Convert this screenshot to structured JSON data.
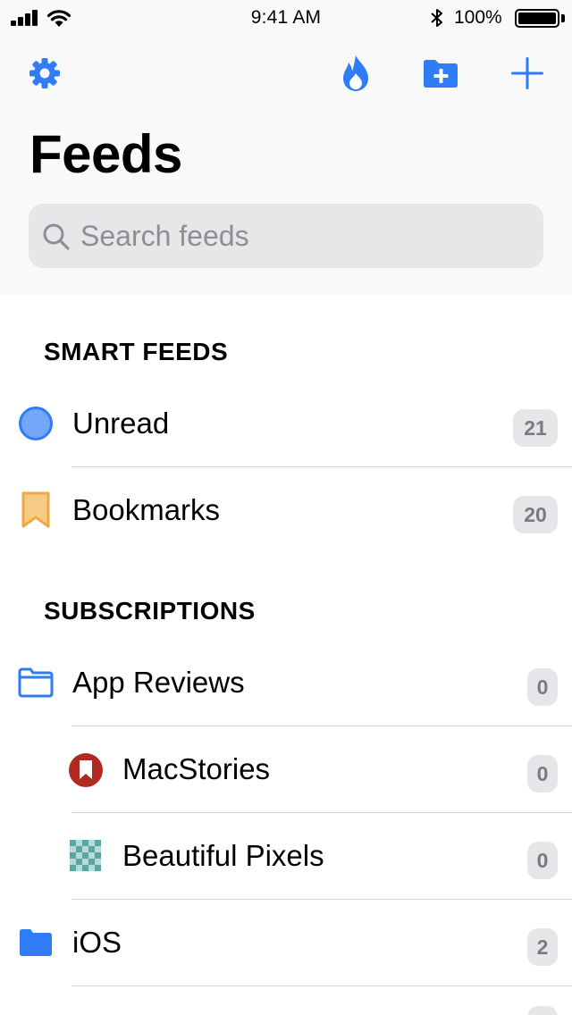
{
  "status_bar": {
    "time": "9:41 AM",
    "battery": "100%",
    "icons": [
      "signal-icon",
      "wifi-icon",
      "bluetooth-icon",
      "battery-icon"
    ]
  },
  "nav": {
    "title": "Feeds",
    "icons": [
      "gear-icon",
      "flame-icon",
      "folder-plus-icon",
      "plus-icon"
    ],
    "accent_color": "#2f7cf6"
  },
  "search": {
    "placeholder": "Search feeds",
    "value": ""
  },
  "smart_feeds": {
    "header": "SMART FEEDS",
    "items": [
      {
        "label": "Unread",
        "count": "21",
        "icon": "unread-circle-icon"
      },
      {
        "label": "Bookmarks",
        "count": "20",
        "icon": "bookmark-icon"
      }
    ]
  },
  "subscriptions": {
    "header": "SUBSCRIPTIONS",
    "items": [
      {
        "label": "App Reviews",
        "count": "0",
        "icon": "folder-outline-icon"
      },
      {
        "label": "MacStories",
        "count": "0",
        "icon": "macstories-icon"
      },
      {
        "label": "Beautiful Pixels",
        "count": "0",
        "icon": "beautiful-pixels-icon"
      },
      {
        "label": "iOS",
        "count": "2",
        "icon": "folder-filled-icon"
      }
    ]
  }
}
